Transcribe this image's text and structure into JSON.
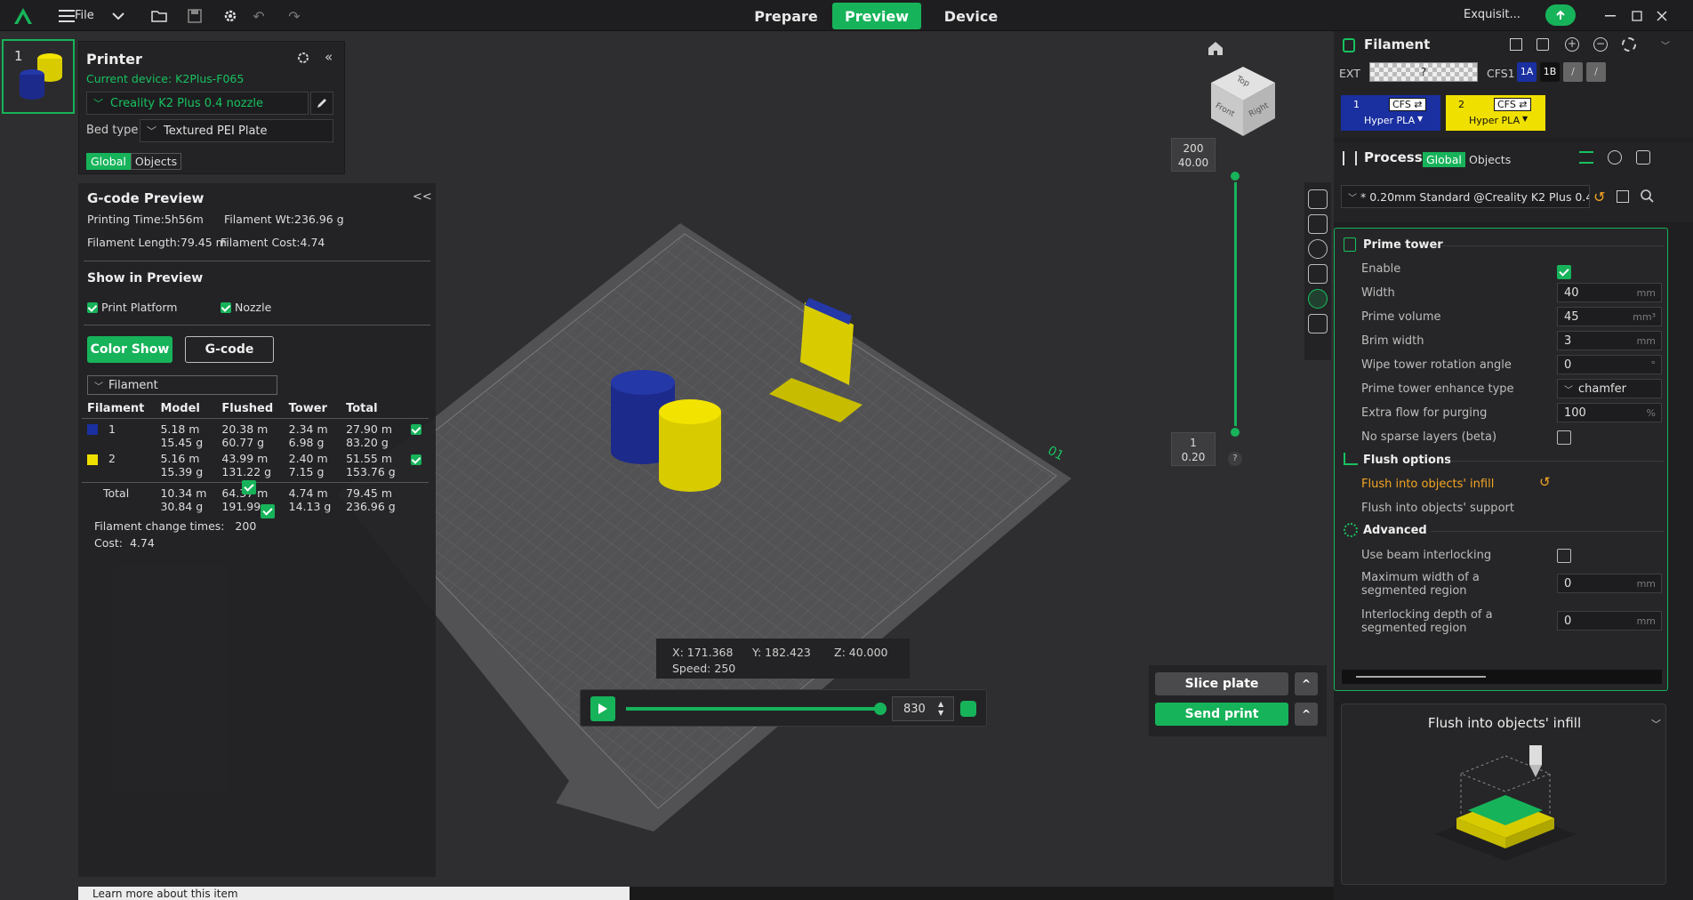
{
  "topbar": {
    "file_label": "File",
    "tabs": [
      {
        "label": "Prepare"
      },
      {
        "label": "Preview"
      },
      {
        "label": "Device"
      }
    ],
    "account_label": "Exquisit...",
    "colors": {
      "accent": "#17b35a"
    }
  },
  "plate_thumb": {
    "number": "1"
  },
  "printer": {
    "title": "Printer",
    "current_device": "Current device: K2Plus-F065",
    "nozzle": "Creality K2 Plus 0.4 nozzle",
    "bed_type_label": "Bed type",
    "bed_type_value": "Textured PEI Plate",
    "toggle": {
      "global": "Global",
      "objects": "Objects"
    },
    "collapse": "«"
  },
  "gcode": {
    "title": "G-code Preview",
    "collapse": "<<",
    "printing_time": "Printing Time:5h56m",
    "filament_wt": "Filament Wt:236.96 g",
    "filament_length": "Filament Length:79.45 m",
    "filament_cost": "Filament Cost:4.74",
    "show_title": "Show in Preview",
    "print_platform": "Print Platform",
    "nozzle": "Nozzle",
    "color_show": "Color Show",
    "gcode_btn": "G-code",
    "dropdown": "Filament",
    "table": {
      "headers": [
        "Filament",
        "Model",
        "Flushed",
        "Tower",
        "Total"
      ],
      "rows": [
        {
          "id": "1",
          "color": "#1a2fa0",
          "model": [
            "5.18 m",
            "15.45 g"
          ],
          "flushed": [
            "20.38 m",
            "60.77 g"
          ],
          "tower": [
            "2.34 m",
            "6.98 g"
          ],
          "total": [
            "27.90 m",
            "83.20 g"
          ]
        },
        {
          "id": "2",
          "color": "#f0e000",
          "model": [
            "5.16 m",
            "15.39 g"
          ],
          "flushed": [
            "43.99 m",
            "131.22 g"
          ],
          "tower": [
            "2.40 m",
            "7.15 g"
          ],
          "total": [
            "51.55 m",
            "153.76 g"
          ]
        }
      ],
      "total": {
        "label": "Total",
        "model": [
          "10.34 m",
          "30.84 g"
        ],
        "flushed": [
          "64.37 m",
          "191.99 g"
        ],
        "tower": [
          "4.74 m",
          "14.13 g"
        ],
        "total": [
          "79.45 m",
          "236.96 g"
        ]
      }
    },
    "change_times": "Filament change times:   200",
    "cost": "Cost:  4.74"
  },
  "viewport": {
    "plate_label": "01",
    "cube": {
      "top": "Top",
      "front": "Front",
      "right": "Right"
    },
    "layer_top": {
      "layer": "200",
      "height": "40.00"
    },
    "layer_bottom": {
      "layer": "1",
      "height": "0.20"
    },
    "help": "?",
    "coords": {
      "x": "X: 171.368",
      "y": "Y: 182.423",
      "z": "Z: 40.000",
      "speed": "Speed: 250"
    },
    "playback_value": "830",
    "playback_fraction": 1.0,
    "slice_plate": "Slice plate",
    "send_print": "Send print",
    "caret": "^",
    "learn_more": "Learn more about this item"
  },
  "filament": {
    "title": "Filament",
    "ext": "EXT",
    "ext_slot": "?",
    "cfs": "CFS1",
    "slot_1a": "1A",
    "slot_1b": "1B",
    "slot_s1": "/",
    "slot_s2": "/",
    "cards": [
      {
        "num": "1",
        "tag": "CFS ⇄",
        "type": "Hyper PLA",
        "bg": "#1a2fa0",
        "fg": "#ffffff"
      },
      {
        "num": "2",
        "tag": "CFS ⇄",
        "type": "Hyper PLA",
        "bg": "#f0e000",
        "fg": "#111111"
      }
    ]
  },
  "process": {
    "title": "Process",
    "toggle": {
      "global": "Global",
      "objects": "Objects"
    },
    "preset": "* 0.20mm Standard @Creality K2 Plus 0.4 ...",
    "sections": {
      "prime_tower": "Prime tower",
      "flush": "Flush options",
      "advanced": "Advanced"
    },
    "fields": {
      "enable": "Enable",
      "width": "Width",
      "width_val": "40",
      "width_unit": "mm",
      "prime_volume": "Prime volume",
      "prime_volume_val": "45",
      "prime_volume_unit": "mm³",
      "brim_width": "Brim width",
      "brim_width_val": "3",
      "brim_width_unit": "mm",
      "rotation": "Wipe tower rotation angle",
      "rotation_val": "0",
      "rotation_unit": "°",
      "enhance": "Prime tower enhance type",
      "enhance_val": "chamfer",
      "extra_flow": "Extra flow for purging",
      "extra_flow_val": "100",
      "extra_flow_unit": "%",
      "no_sparse": "No sparse layers (beta)",
      "flush_infill": "Flush into objects' infill",
      "flush_support": "Flush into objects' support",
      "beam": "Use beam interlocking",
      "max_width": "Maximum width of a segmented region",
      "max_width_val": "0",
      "max_width_unit": "mm",
      "depth": "Interlocking depth of a segmented region",
      "depth_val": "0",
      "depth_unit": "mm"
    },
    "colors": {
      "modified": "#f5a623"
    }
  },
  "help_panel": {
    "title": "Flush into objects' infill"
  }
}
